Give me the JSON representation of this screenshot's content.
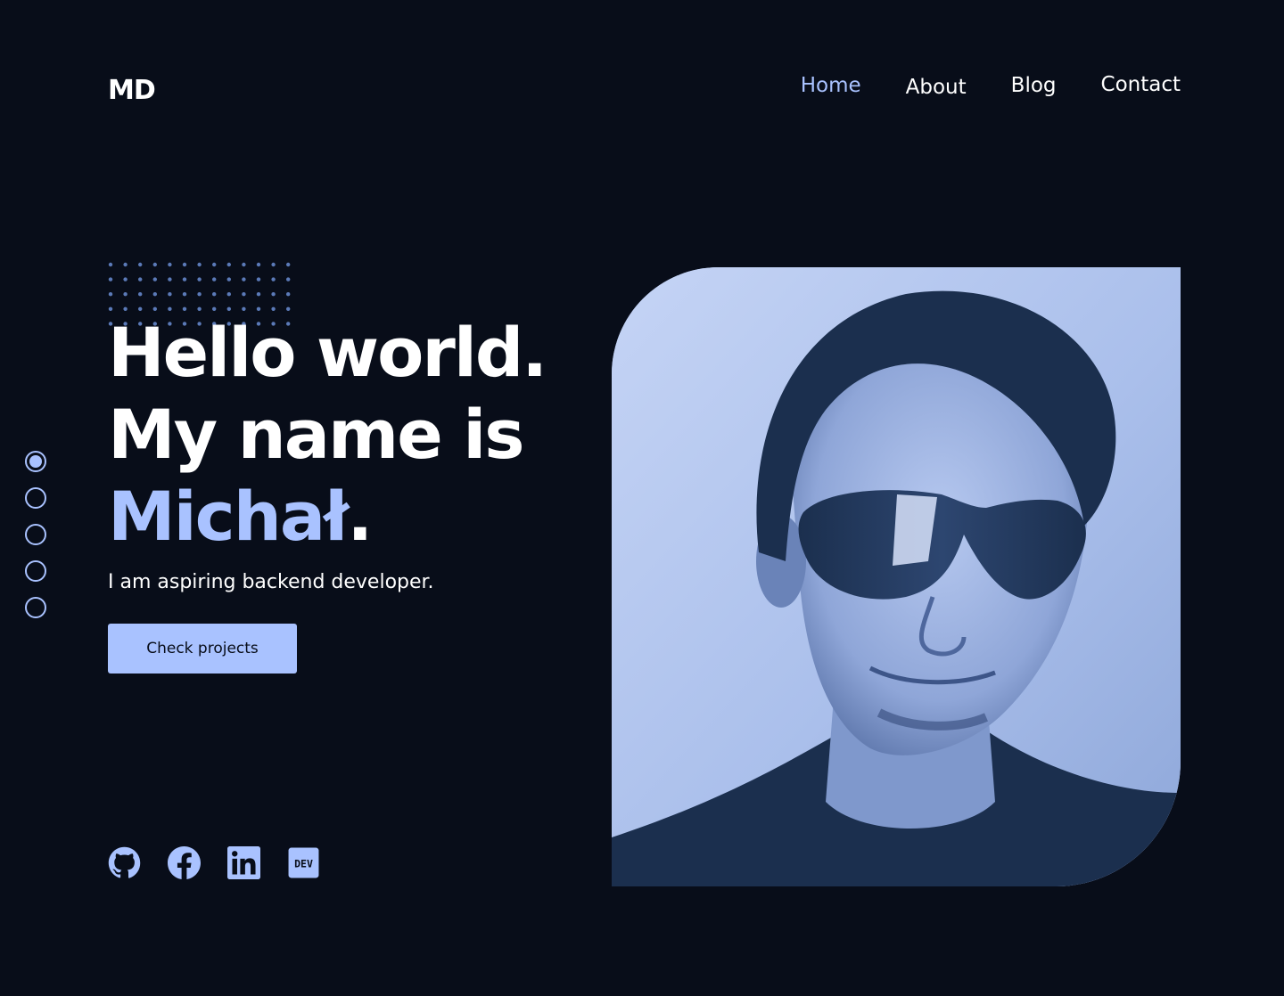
{
  "header": {
    "logo": "MD",
    "nav": [
      {
        "label": "Home",
        "active": true
      },
      {
        "label": "About",
        "active": false
      },
      {
        "label": "Blog",
        "active": false
      },
      {
        "label": "Contact",
        "active": false
      }
    ]
  },
  "hero": {
    "line1": "Hello world.",
    "line2": "My name is",
    "name": "Michał",
    "name_suffix": ".",
    "subtitle": "I am aspiring backend developer.",
    "cta_label": "Check projects"
  },
  "section_nav": {
    "count": 5,
    "active_index": 0
  },
  "socials": [
    {
      "icon": "github-icon"
    },
    {
      "icon": "facebook-icon"
    },
    {
      "icon": "linkedin-icon"
    },
    {
      "icon": "dev-icon",
      "text": "DEV"
    }
  ],
  "colors": {
    "background": "#080d19",
    "accent": "#a9c2ff",
    "text": "#ffffff",
    "photo_dark": "#1b2f4e",
    "photo_light": "#b0c4ef"
  }
}
